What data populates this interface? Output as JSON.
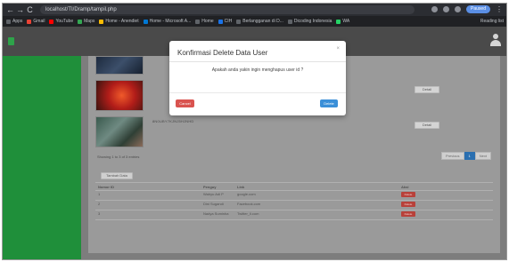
{
  "browser": {
    "nav": {
      "back": "←",
      "forward": "→",
      "reload": "C"
    },
    "address": "localhost/TI/Dramp/tampil.php",
    "profile_label": "Paused",
    "menu": "⋮",
    "bookmarks": [
      {
        "label": "Apps",
        "color": "#5f6368"
      },
      {
        "label": "Gmail",
        "color": "#ea4335"
      },
      {
        "label": "YouTube",
        "color": "#ff0000"
      },
      {
        "label": "Maps",
        "color": "#34a853"
      },
      {
        "label": "Home - Anendiet",
        "color": "#fbbc04"
      },
      {
        "label": "Home - Microsoft A...",
        "color": "#0078d4"
      },
      {
        "label": "Home",
        "color": "#5f6368"
      },
      {
        "label": "CIH",
        "color": "#1a73e8"
      },
      {
        "label": "Berlangganan di D...",
        "color": "#5f6368"
      },
      {
        "label": "Dicoding Indonesia",
        "color": "#5f6368"
      },
      {
        "label": "WA",
        "color": "#25d366"
      }
    ],
    "reading_list": "Reading list"
  },
  "content": {
    "hash_text": "8N0UBY7KJNJ5HJNHD",
    "edit_label": "Detail",
    "showing_text": "Showing 1 to 3 of 3 entries",
    "pager": [
      "Previous",
      "1",
      "Next"
    ],
    "add_label": "Tambah Data",
    "table": {
      "headers": [
        "Nomor ID",
        "Penguy",
        "Link",
        "Aksi"
      ],
      "rows": [
        {
          "id": "1",
          "penguy": "Wahyu Adi P",
          "link": "google.com",
          "action": "Delete"
        },
        {
          "id": "2",
          "penguy": "Dini Sugandi",
          "link": "Facebook.com",
          "action": "Delete"
        },
        {
          "id": "3",
          "penguy": "Nadya Suminha",
          "link": "Twitter_li.com",
          "action": "Delete"
        }
      ]
    }
  },
  "modal": {
    "title": "Konfirmasi Delete Data User",
    "close": "×",
    "message": "Apakah anda yakin ingin menghapus user id ?",
    "cancel_label": "Cancel",
    "ok_label": "Delete"
  }
}
